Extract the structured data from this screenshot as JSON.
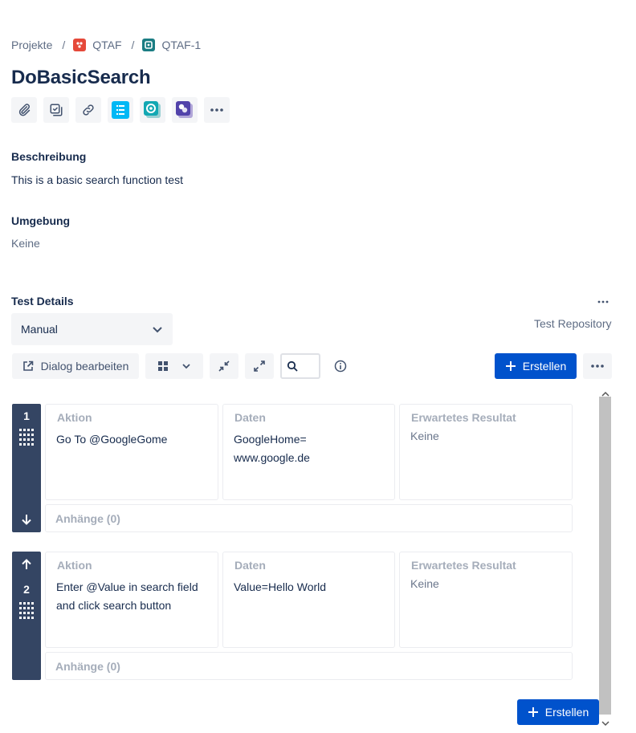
{
  "breadcrumb": {
    "projects": "Projekte",
    "separator": "/",
    "project": "QTAF",
    "issue": "QTAF-1"
  },
  "issue": {
    "title": "DoBasicSearch"
  },
  "toolbar": {
    "icons": [
      "attachment-icon",
      "subtask-icon",
      "link-icon",
      "checklist-app-icon",
      "test-app-icon",
      "xray-app-icon",
      "more-icon"
    ]
  },
  "description": {
    "label": "Beschreibung",
    "value": "This is a basic search function test"
  },
  "environment": {
    "label": "Umgebung",
    "value": "Keine"
  },
  "test_details": {
    "label": "Test Details",
    "more": "...",
    "type_selected": "Manual",
    "repository": "Test Repository",
    "edit_dialog": "Dialog bearbeiten",
    "create_label": "Erstellen",
    "more_label": "..."
  },
  "steps": [
    {
      "number": "1",
      "action_header": "Aktion",
      "action": "Go To @GoogleGome",
      "data_header": "Daten",
      "data_lines": [
        "GoogleHome=",
        "www.google.de"
      ],
      "result_header": "Erwartetes Resultat",
      "result": "Keine",
      "attachments": "Anhänge (0)"
    },
    {
      "number": "2",
      "action_header": "Aktion",
      "action_lines": [
        "Enter @Value in search field",
        "and click search button"
      ],
      "data_header": "Daten",
      "data": "Value=Hello World",
      "result_header": "Erwartetes Resultat",
      "result": "Keine",
      "attachments": "Anhänge (0)"
    }
  ],
  "footer": {
    "create_label": "Erstellen"
  },
  "colors": {
    "primary": "#0052cc",
    "step_bar": "#344563",
    "project_icon": "#e5493a",
    "issue_icon": "#1b7d83"
  }
}
